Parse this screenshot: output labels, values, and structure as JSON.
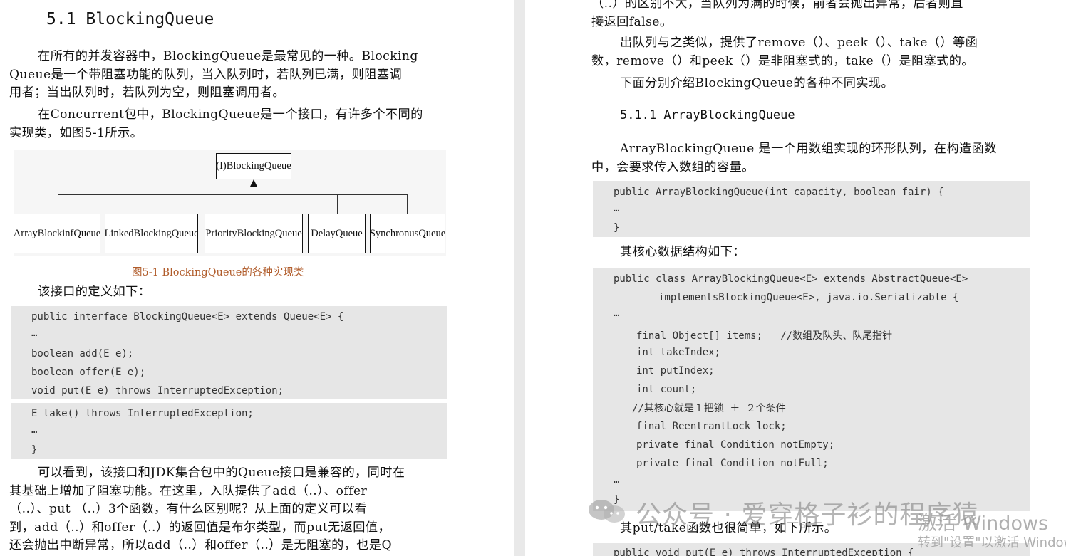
{
  "left": {
    "heading": "5.1 BlockingQueue",
    "p1": [
      "在所有的并发容器中，BlockingQueue是最常见的一种。Blocking",
      "Queue是一个带阻塞功能的队列，当入队列时，若队列已满，则阻塞调",
      "用者；当出队列时，若队列为空，则阻塞调用者。"
    ],
    "p2": [
      "在Concurrent包中，BlockingQueue是一个接口，有许多个不同的",
      "实现类，如图5-1所示。"
    ],
    "diagram": {
      "root": "(I)BlockingQueue",
      "children": [
        "ArrayBlockinfQueue",
        "LinkedBlockingQueue",
        "PriorityBlockingQueue",
        "DelayQueue",
        "SynchronusQueue"
      ]
    },
    "caption": "图5-1 BlockingQueue的各种实现类",
    "p3": "该接口的定义如下：",
    "code1": [
      "public interface BlockingQueue<E> extends Queue<E> {",
      "…",
      "boolean add(E e);",
      "boolean offer(E e);",
      "void put(E e) throws InterruptedException;"
    ],
    "code2": [
      "E take() throws InterruptedException;",
      "…",
      "}"
    ],
    "p4": [
      "可以看到，该接口和JDK集合包中的Queue接口是兼容的，同时在",
      "其基础上增加了阻塞功能。在这里，入队提供了add（..）、offer",
      "（..）、put （..）3个函数，有什么区别呢？从上面的定义可以看",
      "到，add（..）和offer（..）的返回值是布尔类型，而put无返回值，",
      "还会抛出中断异常，所以add（..）和offer（..）是无阻塞的，也是Q"
    ]
  },
  "right": {
    "p1": [
      "（..）的区别不大，当队列为满的时候，前者会抛出异常，后者则直",
      "接返回false。"
    ],
    "p2": [
      "出队列与之类似，提供了remove（）、peek（）、take（）等函",
      "数，remove（）和peek（）是非阻塞式的，take（）是阻塞式的。"
    ],
    "p3": "下面分别介绍BlockingQueue的各种不同实现。",
    "heading": "5.1.1 ArrayBlockingQueue",
    "p4": [
      "ArrayBlockingQueue 是一个用数组实现的环形队列，在构造函数",
      "中，会要求传入数组的容量。"
    ],
    "code1": [
      "public ArrayBlockingQueue(int capacity, boolean fair) {",
      "…",
      "}"
    ],
    "p5": "其核心数据结构如下：",
    "code2": [
      "public class ArrayBlockingQueue<E> extends AbstractQueue<E>",
      "implementsBlockingQueue<E>, java.io.Serializable {",
      "…",
      "final Object[] items;   //数组及队头、队尾指针",
      "int takeIndex;",
      "int putIndex;",
      "int count;",
      "//其核心就是１把锁 ＋ ２个条件",
      "final ReentrantLock lock;",
      "private final Condition notEmpty;",
      "private final Condition notFull;",
      "…",
      "}"
    ],
    "p6": "其put/take函数也很简单，如下所示。",
    "code3": "public void put(E e) throws InterruptedException {"
  },
  "watermark": "公众号 · 爱穿格子衫的程序猿",
  "activate": [
    "激活 Windows",
    "转到\"设置\"以激活 Windows。"
  ]
}
